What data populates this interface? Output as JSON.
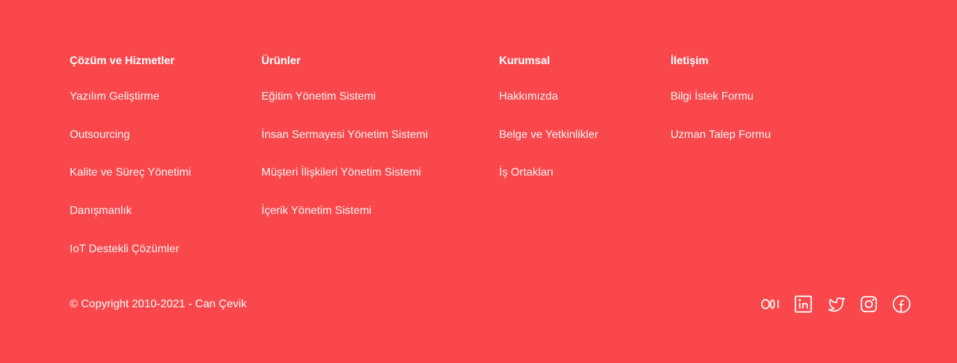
{
  "footer": {
    "columns": [
      {
        "title": "Çözüm ve Hizmetler",
        "links": [
          "Yazılım Geliştirme",
          "Outsourcing",
          "Kalite ve Süreç Yönetimi",
          "Danışmanlık",
          "IoT Destekli Çözümler"
        ]
      },
      {
        "title": "Ürünler",
        "links": [
          "Eğitim Yönetim Sistemi",
          "İnsan Sermayesi Yönetim Sistemi",
          "Müşteri İlişkileri Yönetim Sistemi",
          "İçerik Yönetim Sistemi"
        ]
      },
      {
        "title": "Kurumsal",
        "links": [
          "Hakkımızda",
          "Belge ve Yetkinlikler",
          "İş Ortakları"
        ]
      },
      {
        "title": "İletişim",
        "links": [
          "Bilgi İstek Formu",
          "Uzman Talep Formu"
        ]
      }
    ],
    "copyright": "© Copyright 2010-2021 - Can Çevik",
    "socials": [
      {
        "icon": "medium-icon"
      },
      {
        "icon": "linkedin-icon"
      },
      {
        "icon": "twitter-icon"
      },
      {
        "icon": "instagram-icon"
      },
      {
        "icon": "facebook-icon"
      }
    ],
    "colors": {
      "background": "#fa474c",
      "text": "#ffffff"
    }
  }
}
